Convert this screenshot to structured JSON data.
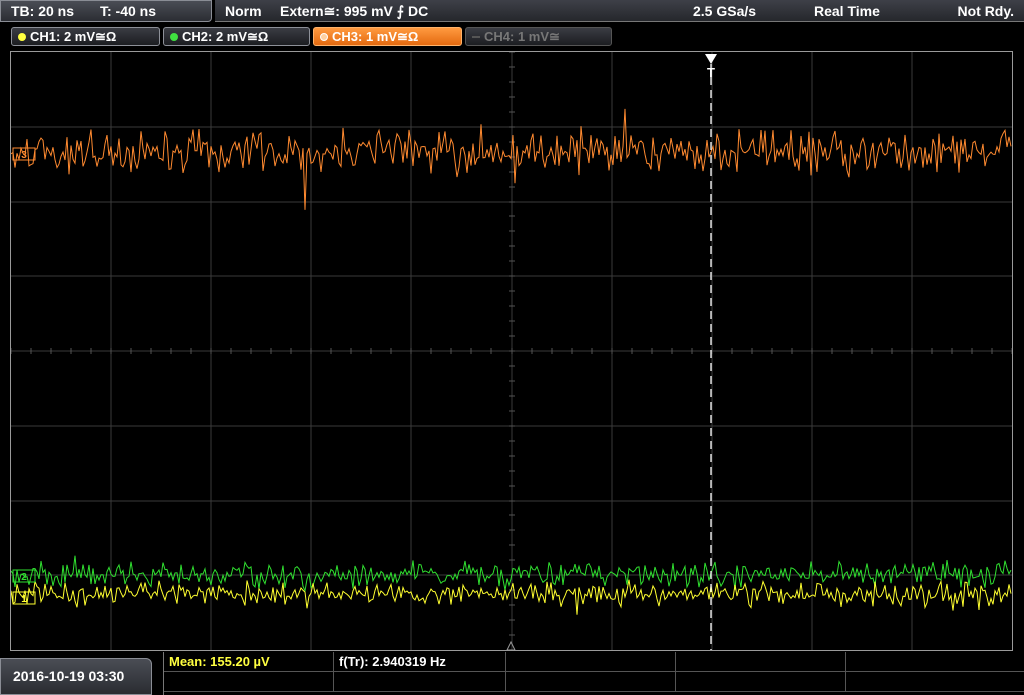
{
  "timebase": {
    "tb_label": "TB: 20 ns",
    "trigger_time": "T: -40 ns"
  },
  "status": {
    "mode": "Norm",
    "trigger_source": "Extern≅: 995 mV ⨍ DC",
    "sample_rate": "2.5 GSa/s",
    "acq_mode": "Real Time",
    "ready_state": "Not Rdy."
  },
  "channels": [
    {
      "label": "CH1: 2 mV≅Ω",
      "color": "#ffff40",
      "state": "on"
    },
    {
      "label": "CH2: 2 mV≅Ω",
      "color": "#40e040",
      "state": "on"
    },
    {
      "label": "CH3: 1 mV≅Ω",
      "color": "#ff8c30",
      "state": "active"
    },
    {
      "label": "CH4: 1 mV≅",
      "color": "#777777",
      "state": "off"
    }
  ],
  "markers": {
    "trigger": "T",
    "ch3": "3",
    "ch2": "2",
    "ch1": "1"
  },
  "colors": {
    "ch1": "#ffff30",
    "ch2": "#30e030",
    "ch3": "#ff8a30",
    "grid": "#3a3a3a",
    "accent": "#ff8c30"
  },
  "footer": {
    "datetime": "2016-10-19 03:30",
    "mean": "Mean: 155.20 µV",
    "freq": "f(Tr): 2.940319 Hz"
  }
}
